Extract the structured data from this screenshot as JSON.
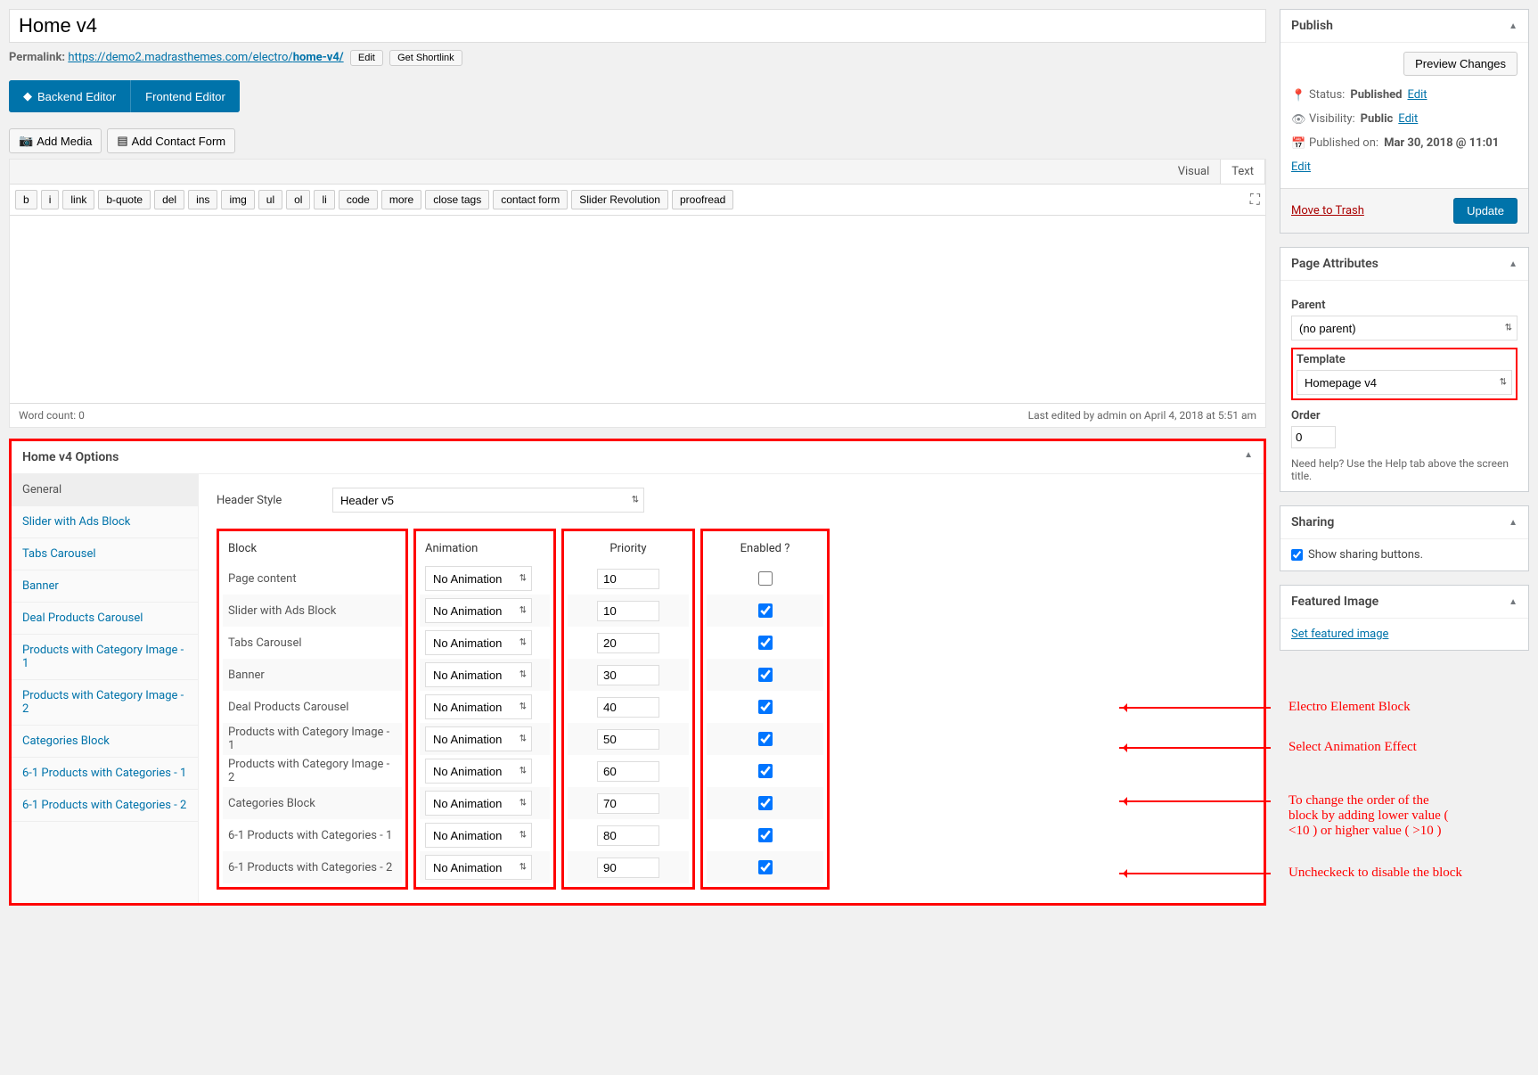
{
  "title": "Home v4",
  "permalink": {
    "label": "Permalink:",
    "url_base": "https://demo2.madrasthemes.com/electro/",
    "url_slug": "home-v4/",
    "edit": "Edit",
    "shortlink": "Get Shortlink"
  },
  "editor_modes": {
    "backend": "Backend Editor",
    "frontend": "Frontend Editor"
  },
  "media": {
    "add_media": "Add Media",
    "add_contact": "Add Contact Form"
  },
  "editor_tabs": {
    "visual": "Visual",
    "text": "Text"
  },
  "quicktags": [
    "b",
    "i",
    "link",
    "b-quote",
    "del",
    "ins",
    "img",
    "ul",
    "ol",
    "li",
    "code",
    "more",
    "close tags",
    "contact form",
    "Slider Revolution",
    "proofread"
  ],
  "editor_footer": {
    "word_count": "Word count: 0",
    "last_edit": "Last edited by admin on April 4, 2018 at 5:51 am"
  },
  "publish": {
    "title": "Publish",
    "preview": "Preview Changes",
    "status_label": "Status:",
    "status_value": "Published",
    "status_edit": "Edit",
    "visibility_label": "Visibility:",
    "visibility_value": "Public",
    "visibility_edit": "Edit",
    "published_label": "Published on:",
    "published_value": "Mar 30, 2018 @ 11:01",
    "published_edit": "Edit",
    "trash": "Move to Trash",
    "update": "Update"
  },
  "page_attributes": {
    "title": "Page Attributes",
    "parent_label": "Parent",
    "parent_value": "(no parent)",
    "template_label": "Template",
    "template_value": "Homepage v4",
    "order_label": "Order",
    "order_value": "0",
    "help": "Need help? Use the Help tab above the screen title."
  },
  "sharing": {
    "title": "Sharing",
    "show_label": "Show sharing buttons."
  },
  "featured_image": {
    "title": "Featured Image",
    "set_link": "Set featured image"
  },
  "options": {
    "title": "Home v4 Options",
    "tabs": [
      "General",
      "Slider with Ads Block",
      "Tabs Carousel",
      "Banner",
      "Deal Products Carousel",
      "Products with Category Image - 1",
      "Products with Category Image - 2",
      "Categories Block",
      "6-1 Products with Categories - 1",
      "6-1 Products with Categories - 2"
    ],
    "header_style_label": "Header Style",
    "header_style_value": "Header v5",
    "columns": {
      "block": "Block",
      "animation": "Animation",
      "priority": "Priority",
      "enabled": "Enabled ?"
    },
    "rows": [
      {
        "name": "Page content",
        "animation": "No Animation",
        "priority": "10",
        "enabled": false
      },
      {
        "name": "Slider with Ads Block",
        "animation": "No Animation",
        "priority": "10",
        "enabled": true
      },
      {
        "name": "Tabs Carousel",
        "animation": "No Animation",
        "priority": "20",
        "enabled": true
      },
      {
        "name": "Banner",
        "animation": "No Animation",
        "priority": "30",
        "enabled": true
      },
      {
        "name": "Deal Products Carousel",
        "animation": "No Animation",
        "priority": "40",
        "enabled": true
      },
      {
        "name": "Products with Category Image - 1",
        "animation": "No Animation",
        "priority": "50",
        "enabled": true
      },
      {
        "name": "Products with Category Image - 2",
        "animation": "No Animation",
        "priority": "60",
        "enabled": true
      },
      {
        "name": "Categories Block",
        "animation": "No Animation",
        "priority": "70",
        "enabled": true
      },
      {
        "name": "6-1 Products with Categories - 1",
        "animation": "No Animation",
        "priority": "80",
        "enabled": true
      },
      {
        "name": "6-1 Products with Categories - 2",
        "animation": "No Animation",
        "priority": "90",
        "enabled": true
      }
    ]
  },
  "annotations": {
    "a1": "Electro Element Block",
    "a2": "Select Animation Effect",
    "a3": "To change the  order of the block  by adding lower value ( <10 )  or higher value ( >10 )",
    "a4": "Uncheckeck to disable the block"
  }
}
